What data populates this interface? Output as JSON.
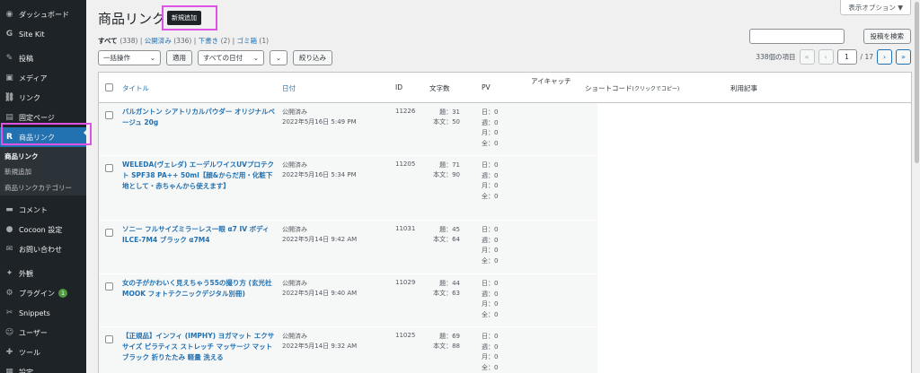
{
  "sidebar": {
    "items": [
      {
        "icon": "dashboard-icon",
        "glyph": "◉",
        "label": "ダッシュボード"
      },
      {
        "icon": "sitekit-icon",
        "glyph": "G",
        "label": "Site Kit"
      },
      {
        "icon": "pin-icon",
        "glyph": "✎",
        "label": "投稿"
      },
      {
        "icon": "media-icon",
        "glyph": "▣",
        "label": "メディア"
      },
      {
        "icon": "link-icon",
        "glyph": "⛓",
        "label": "リンク"
      },
      {
        "icon": "page-icon",
        "glyph": "▤",
        "label": "固定ページ"
      },
      {
        "icon": "rinker-icon",
        "glyph": "R",
        "label": "商品リンク"
      },
      {
        "icon": "comment-icon",
        "glyph": "▬",
        "label": "コメント"
      },
      {
        "icon": "cocoon-icon",
        "glyph": "●",
        "label": "Cocoon 設定"
      },
      {
        "icon": "mail-icon",
        "glyph": "✉",
        "label": "お問い合わせ"
      },
      {
        "icon": "appearance-icon",
        "glyph": "✦",
        "label": "外観"
      },
      {
        "icon": "plugin-icon",
        "glyph": "⚙",
        "label": "プラグイン",
        "badge": "1"
      },
      {
        "icon": "snippets-icon",
        "glyph": "✂",
        "label": "Snippets"
      },
      {
        "icon": "user-icon",
        "glyph": "☺",
        "label": "ユーザー"
      },
      {
        "icon": "tools-icon",
        "glyph": "✚",
        "label": "ツール"
      },
      {
        "icon": "settings-icon",
        "glyph": "▦",
        "label": "設定"
      }
    ],
    "submenu": [
      "商品リンク",
      "新規追加",
      "商品リンクカテゴリー"
    ]
  },
  "header": {
    "screen_options": "表示オプション ▼",
    "title": "商品リンク",
    "add_new": "新規追加"
  },
  "filters": {
    "all": "すべて",
    "all_count": "(338)",
    "published": "公開済み",
    "published_count": "(336)",
    "draft": "下書き",
    "draft_count": "(2)",
    "trash": "ゴミ箱",
    "trash_count": "(1)",
    "sep": "|"
  },
  "search": {
    "button": "投稿を検索"
  },
  "tablenav": {
    "bulk": "一括操作",
    "apply": "適用",
    "dates": "すべての日付",
    "filter": "絞り込み",
    "items_count": "338個の項目",
    "first": "«",
    "prev": "‹",
    "page": "1",
    "total": "/ 17",
    "next": "›",
    "last": "»"
  },
  "columns": {
    "title": "タイトル",
    "date": "日付",
    "id": "ID",
    "chars": "文字数",
    "pv": "PV",
    "eyecatch": "アイキャッチ",
    "shortcode": "ショートコード",
    "shortcode_note": "(クリックでコピー)",
    "used_in": "利用記事"
  },
  "rows": [
    {
      "title": "バルガントン シアトリカルパウダー オリジナルベージュ 20g",
      "status": "公開済み",
      "date": "2022年5月16日 5:49 PM",
      "id": "11226",
      "chars1": "題：31",
      "chars2": "本文：50",
      "pv": [
        "日：0",
        "週：0",
        "月：0",
        "全：0"
      ]
    },
    {
      "title": "WELEDA(ヴェレダ) エーデルワイスUVプロテクト SPF38 PA++ 50ml【顔&からだ用・化粧下地として・赤ちゃんから使えます】",
      "status": "公開済み",
      "date": "2022年5月16日 5:34 PM",
      "id": "11205",
      "chars1": "題：71",
      "chars2": "本文：90",
      "pv": [
        "日：0",
        "週：0",
        "月：0",
        "全：0"
      ]
    },
    {
      "title": "ソニー フルサイズミラーレス一眼 α7 IV ボディ ILCE-7M4 ブラック α7M4",
      "status": "公開済み",
      "date": "2022年5月14日 9:42 AM",
      "id": "11031",
      "chars1": "題：45",
      "chars2": "本文：64",
      "pv": [
        "日：0",
        "週：0",
        "月：0",
        "全：0"
      ]
    },
    {
      "title": "女の子がかわいく見えちゃう55の撮り方 (玄光社MOOK フォトテクニックデジタル別冊)",
      "status": "公開済み",
      "date": "2022年5月14日 9:40 AM",
      "id": "11029",
      "chars1": "題：44",
      "chars2": "本文：63",
      "pv": [
        "日：0",
        "週：0",
        "月：0",
        "全：0"
      ]
    },
    {
      "title": "【正規品】インフィ (IMPHY) ヨガマット エクササイズ ピラティス ストレッチ マッサージ マット ブラック 折りたたみ 軽量 洗える",
      "status": "公開済み",
      "date": "2022年5月14日 9:32 AM",
      "id": "11025",
      "chars1": "題：69",
      "chars2": "本文：88",
      "pv": [
        "日：0",
        "週：0",
        "月：0",
        "全：0"
      ]
    }
  ],
  "colors": {
    "accent": "#2271b1",
    "highlight": "#e052e4",
    "sidebar": "#1d2327"
  }
}
